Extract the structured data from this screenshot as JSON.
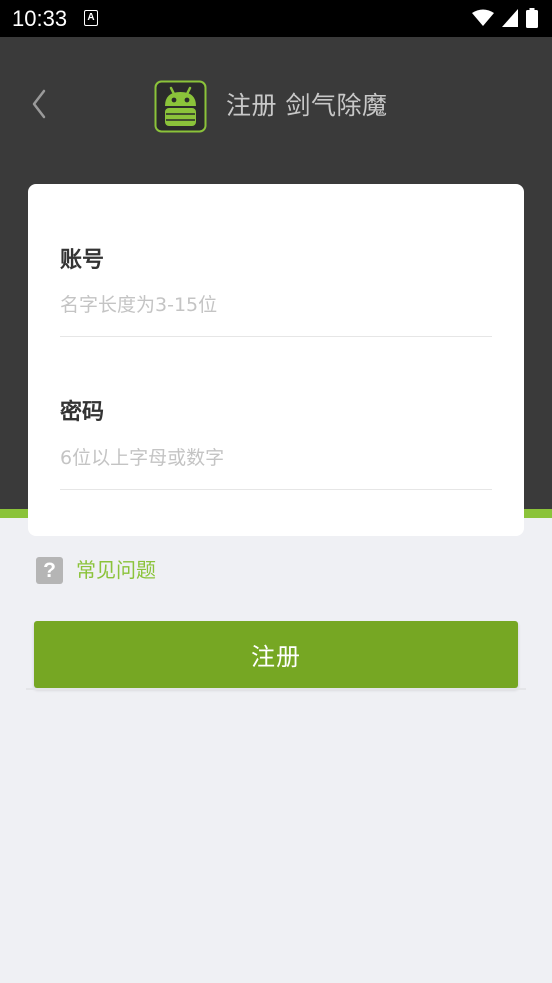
{
  "status_bar": {
    "time": "10:33",
    "notification_icon": "A"
  },
  "header": {
    "back_icon": "chevron-left-icon",
    "logo_icon": "android-robot-icon",
    "title": "注册 剑气除魔"
  },
  "form": {
    "account": {
      "label": "账号",
      "placeholder": "名字长度为3-15位",
      "value": ""
    },
    "password": {
      "label": "密码",
      "placeholder": "6位以上字母或数字",
      "value": ""
    }
  },
  "faq": {
    "icon": "question-mark-icon",
    "label": "常见问题"
  },
  "register_button": {
    "label": "注册"
  },
  "colors": {
    "header_bg": "#3a3a3a",
    "accent_green": "#8bc33a",
    "button_green": "#76a723",
    "page_bg": "#eff0f4"
  }
}
